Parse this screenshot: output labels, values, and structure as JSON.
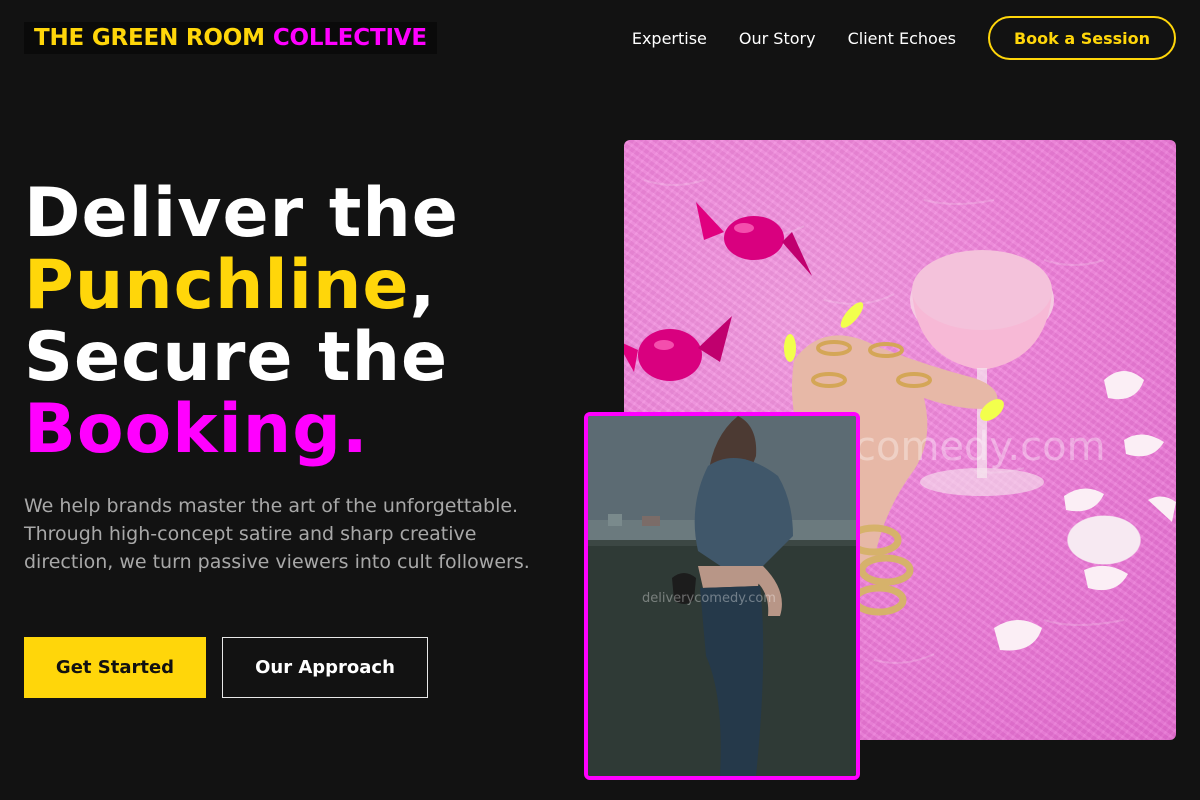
{
  "brand": {
    "part1": "THE GREEN ROOM",
    "part2": "COLLECTIVE"
  },
  "nav": {
    "items": [
      {
        "label": "Expertise"
      },
      {
        "label": "Our Story"
      },
      {
        "label": "Client Echoes"
      }
    ],
    "cta": "Book a Session"
  },
  "hero": {
    "line1": "Deliver the",
    "line2_highlight": "Punchline",
    "line2_suffix": ",",
    "line3": "Secure the",
    "line4_highlight": "Booking.",
    "subtitle": "We help brands master the art of the unforgettable. Through high-concept satire and sharp creative direction, we turn passive viewers into cult followers.",
    "primary_cta": "Get Started",
    "secondary_cta": "Our Approach"
  },
  "images": {
    "main_watermark": "comedy.com",
    "overlay_watermark": "deliverycomedy.com"
  },
  "colors": {
    "background": "#121212",
    "accent_yellow": "#FFD60A",
    "accent_magenta": "#FF00FF",
    "text_muted": "#a8a8a8"
  }
}
